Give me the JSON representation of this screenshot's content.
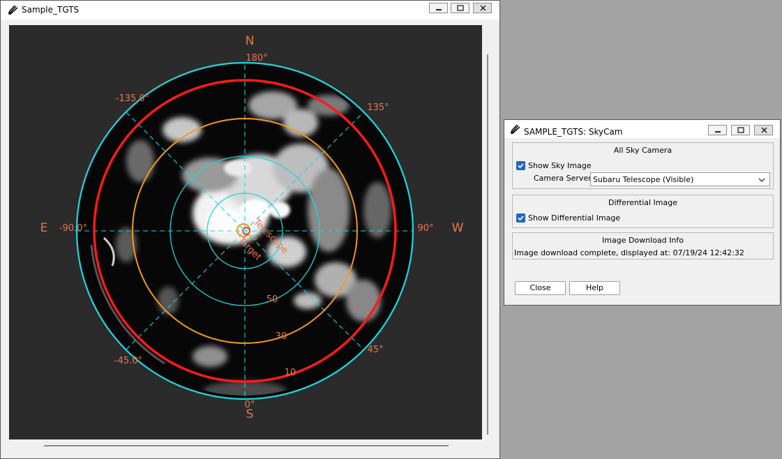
{
  "main_window": {
    "title": "Sample_TGTS",
    "icon": "comet-icon",
    "controls": [
      "minimize-icon",
      "maximize-icon",
      "close-icon"
    ]
  },
  "sky_map": {
    "compass": {
      "north": "N",
      "south": "S",
      "east": "E",
      "west": "W"
    },
    "azimuth_labels": {
      "top": "180°",
      "bottom": "0°",
      "left": "-90.0°",
      "right": "90°",
      "top_left": "-135.0°",
      "top_right": "135°",
      "bottom_left": "-45.0°",
      "bottom_right": "45°"
    },
    "elevation_labels": [
      "50",
      "30",
      "10"
    ],
    "markers": {
      "telescope": "Telescope",
      "target": "Target",
      "target_abbrev": "TS"
    },
    "colors": {
      "background": "#2b2b2b",
      "horizon_ring": "#1fd6e0",
      "limit_ring": "#ff1a1a",
      "warning_ring": "#f39a1c",
      "label": "#e8754f"
    }
  },
  "dialog": {
    "title": "SAMPLE_TGTS: SkyCam",
    "icon": "comet-icon",
    "sky_camera": {
      "heading": "All Sky Camera",
      "show_sky_image": "Show Sky Image",
      "show_sky_image_checked": true,
      "camera_server_label": "Camera Server:",
      "camera_server_value": "Subaru Telescope (Visible)"
    },
    "differential": {
      "heading": "Differential Image",
      "show_diff_image": "Show Differential Image",
      "show_diff_image_checked": true
    },
    "download_info": {
      "heading": "Image Download Info",
      "status": "Image download complete, displayed at: 07/19/24 12:42:32"
    },
    "buttons": {
      "close": "Close",
      "help": "Help"
    }
  }
}
